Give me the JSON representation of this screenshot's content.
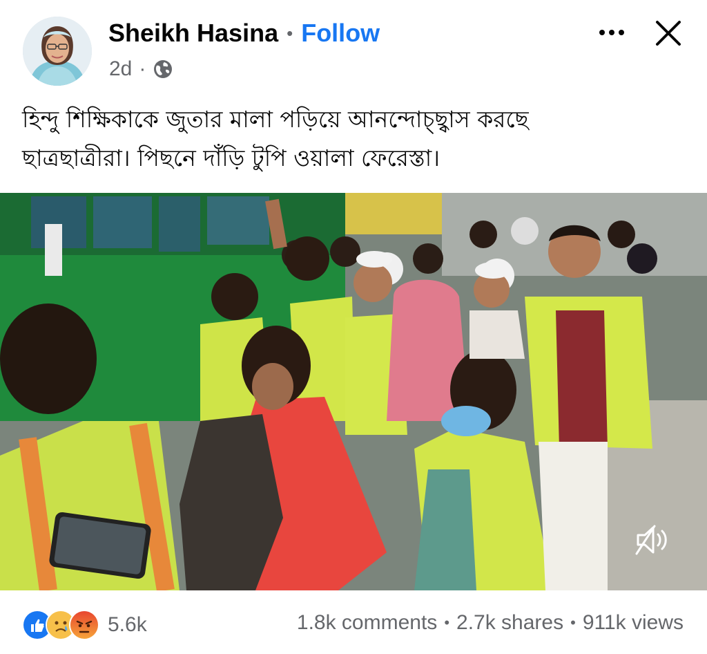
{
  "post": {
    "author": "Sheikh Hasina",
    "separator": "•",
    "follow_label": "Follow",
    "time": "2d",
    "meta_dot": "·",
    "privacy_icon": "globe-icon",
    "caption_line1": "হিন্দু শিক্ষিকাকে জুতার মালা পড়িয়ে আনন্দোচ্ছ্বাস করছে",
    "caption_line2": "ছাত্রছাত্রীরা। পিছনে দাঁড়ি টুপি ওয়ালা ফেরেস্তা।"
  },
  "controls": {
    "more_icon": "more-horizontal-icon",
    "close_icon": "close-icon",
    "sound_icon": "speaker-muted-icon"
  },
  "footer": {
    "reaction_icons": [
      "like-icon",
      "sad-icon",
      "angry-icon"
    ],
    "reactions_count": "5.6k",
    "comments": "1.8k comments",
    "shares": "2.7k shares",
    "views": "911k views",
    "bullet": "•"
  },
  "colors": {
    "brand_blue": "#1877f2",
    "secondary_text": "#65676b",
    "vest_yellow": "#d6e83a"
  }
}
